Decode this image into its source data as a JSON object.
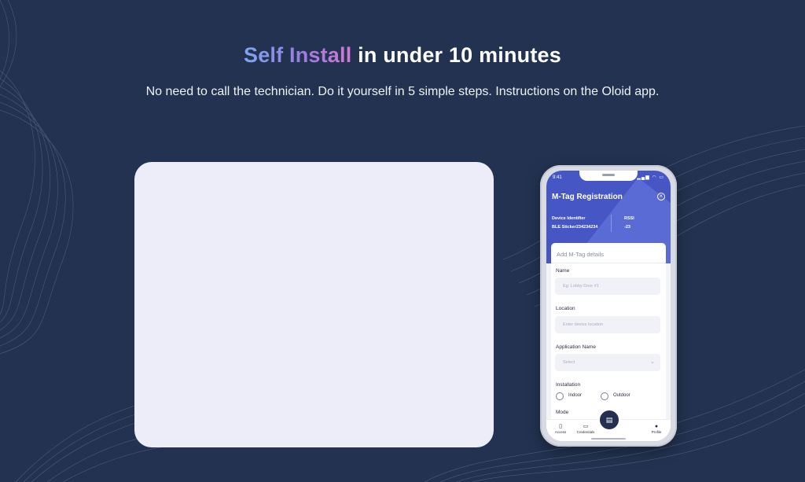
{
  "hero": {
    "title_highlight": "Self Install",
    "title_rest": " in under 10 minutes",
    "subtitle": "No need to call the technician. Do it yourself in 5 simple steps. Instructions on the Oloid app."
  },
  "phone": {
    "status": {
      "time": "9:41",
      "icons": "▂▄▆ ◠ ▭"
    },
    "app_title": "M-Tag Registration",
    "device_identifier_label": "Device Identifier",
    "device_identifier_value": "BLE Sticker234234234",
    "rssi_label": "RSSI",
    "rssi_value": "-23",
    "form": {
      "title": "Add M-Tag details",
      "name_label": "Name",
      "name_placeholder": "Eg: Lobby Door #1",
      "location_label": "Location",
      "location_placeholder": "Enter device location",
      "application_label": "Application Name",
      "application_placeholder": "Select",
      "installation_label": "Installation",
      "option_indoor": "Indoor",
      "option_outdoor": "Outdoor",
      "mode_label": "Mode"
    },
    "nav": {
      "access": "Access",
      "credentials": "Credentials",
      "profile": "Profile"
    }
  },
  "colors": {
    "background": "#223250",
    "app_header": "#4656c4",
    "gradient_start": "#7ea6f0",
    "gradient_end": "#d07ad0"
  }
}
